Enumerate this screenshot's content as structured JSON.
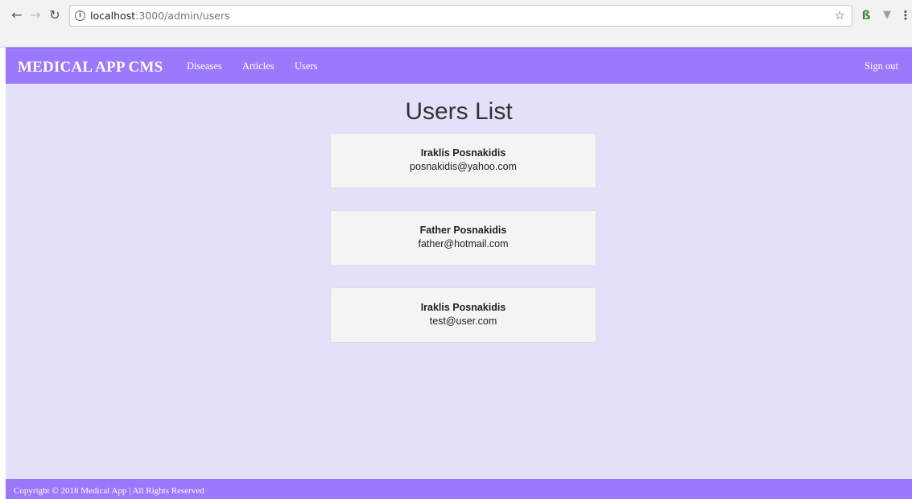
{
  "browser": {
    "url_host": "localhost",
    "url_path": ":3000/admin/users",
    "icons": [
      "back-arrow-icon",
      "forward-arrow-icon",
      "reload-icon",
      "info-icon",
      "star-icon",
      "extension-icon",
      "menu-icon"
    ]
  },
  "navbar": {
    "brand": "MEDICAL APP CMS",
    "links": [
      "Diseases",
      "Articles",
      "Users"
    ],
    "signout": "Sign out"
  },
  "page": {
    "title": "Users List"
  },
  "users": [
    {
      "name": "Iraklis Posnakidis",
      "email": "posnakidis@yahoo.com"
    },
    {
      "name": "Father Posnakidis",
      "email": "father@hotmail.com"
    },
    {
      "name": "Iraklis Posnakidis",
      "email": "test@user.com"
    }
  ],
  "footer": {
    "text": "Copyright © 2018 Medical App | All Rights Reserved"
  },
  "colors": {
    "navbar": "#9b79fd",
    "page_bg": "#e5e0fa",
    "card_bg": "#f4f4f4"
  }
}
